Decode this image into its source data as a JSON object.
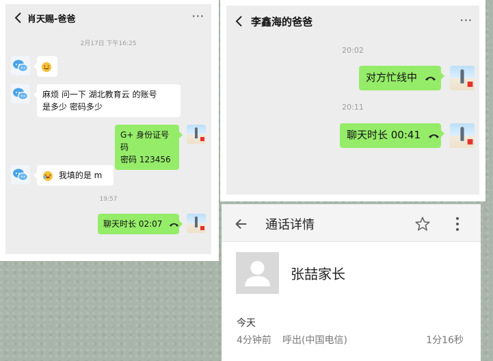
{
  "left_chat": {
    "title": "肖天赐-爸爸",
    "more": "···",
    "timestamp_top": "2月17日 下午16:25",
    "messages": [
      {
        "type": "emoji"
      },
      {
        "text_line1": "麻烦  问一下   湖北教育云  的账号",
        "text_line2": "是多少  密码多少"
      },
      {
        "text_line1": "G+ 身份证号码",
        "text_line2": "密码 123456"
      },
      {
        "text": "我填的是  m"
      }
    ],
    "timestamp_2": "19:57",
    "call_text": "聊天时长 02:07"
  },
  "right_chat": {
    "title": "李鑫海的爸爸",
    "more": "···",
    "timestamp_1": "20:02",
    "busy_text": "对方忙线中",
    "timestamp_2": "20:11",
    "call_text": "聊天时长 00:41"
  },
  "call_detail": {
    "title": "通话详情",
    "contact_name": "张喆家长",
    "day": "今天",
    "time_ago": "4分钟前",
    "call_type": "呼出(中国电信)",
    "duration": "1分16秒"
  },
  "colors": {
    "bubble_green": "#95ec69",
    "chat_bg": "#ededed",
    "page_bg": "#a9b5aa"
  },
  "icons": [
    "back-arrow-icon",
    "more-dots-icon",
    "phone-hangup-icon",
    "star-icon",
    "vertical-dots-icon",
    "contact-placeholder-icon",
    "smile-emoji-icon",
    "laughing-emoji-icon",
    "chat-avatar-icon"
  ]
}
